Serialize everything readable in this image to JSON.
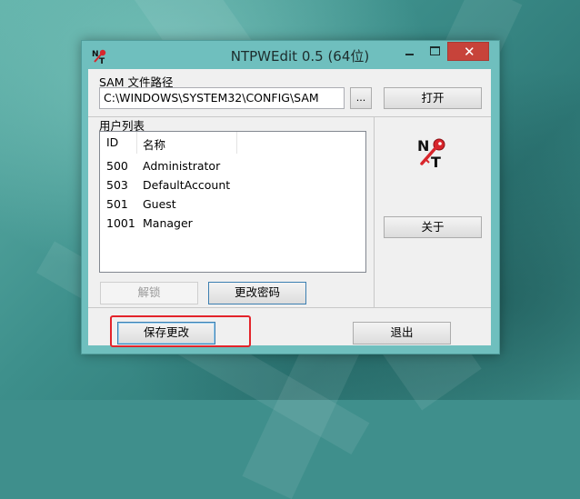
{
  "window": {
    "title": "NTPWEdit 0.5 (64位)",
    "close_glyph": "✕",
    "accent_close": "#c7433a",
    "frame_color": "#6fbfbe"
  },
  "sam": {
    "label": "SAM 文件路径",
    "path_value": "C:\\WINDOWS\\SYSTEM32\\CONFIG\\SAM",
    "browse_label": "...",
    "open_label": "打开"
  },
  "users": {
    "label": "用户列表",
    "columns": [
      "ID",
      "名称"
    ],
    "rows": [
      {
        "id": "500",
        "name": "Administrator"
      },
      {
        "id": "503",
        "name": "DefaultAccount"
      },
      {
        "id": "501",
        "name": "Guest"
      },
      {
        "id": "1001",
        "name": "Manager"
      }
    ]
  },
  "side": {
    "logo_icon": "ntpwedit-key-logo-icon",
    "about_label": "关于"
  },
  "actions": {
    "unlock_label": "解锁",
    "change_password_label": "更改密码",
    "save_label": "保存更改",
    "exit_label": "退出"
  },
  "annotation": {
    "highlight_color": "#e3242b"
  }
}
